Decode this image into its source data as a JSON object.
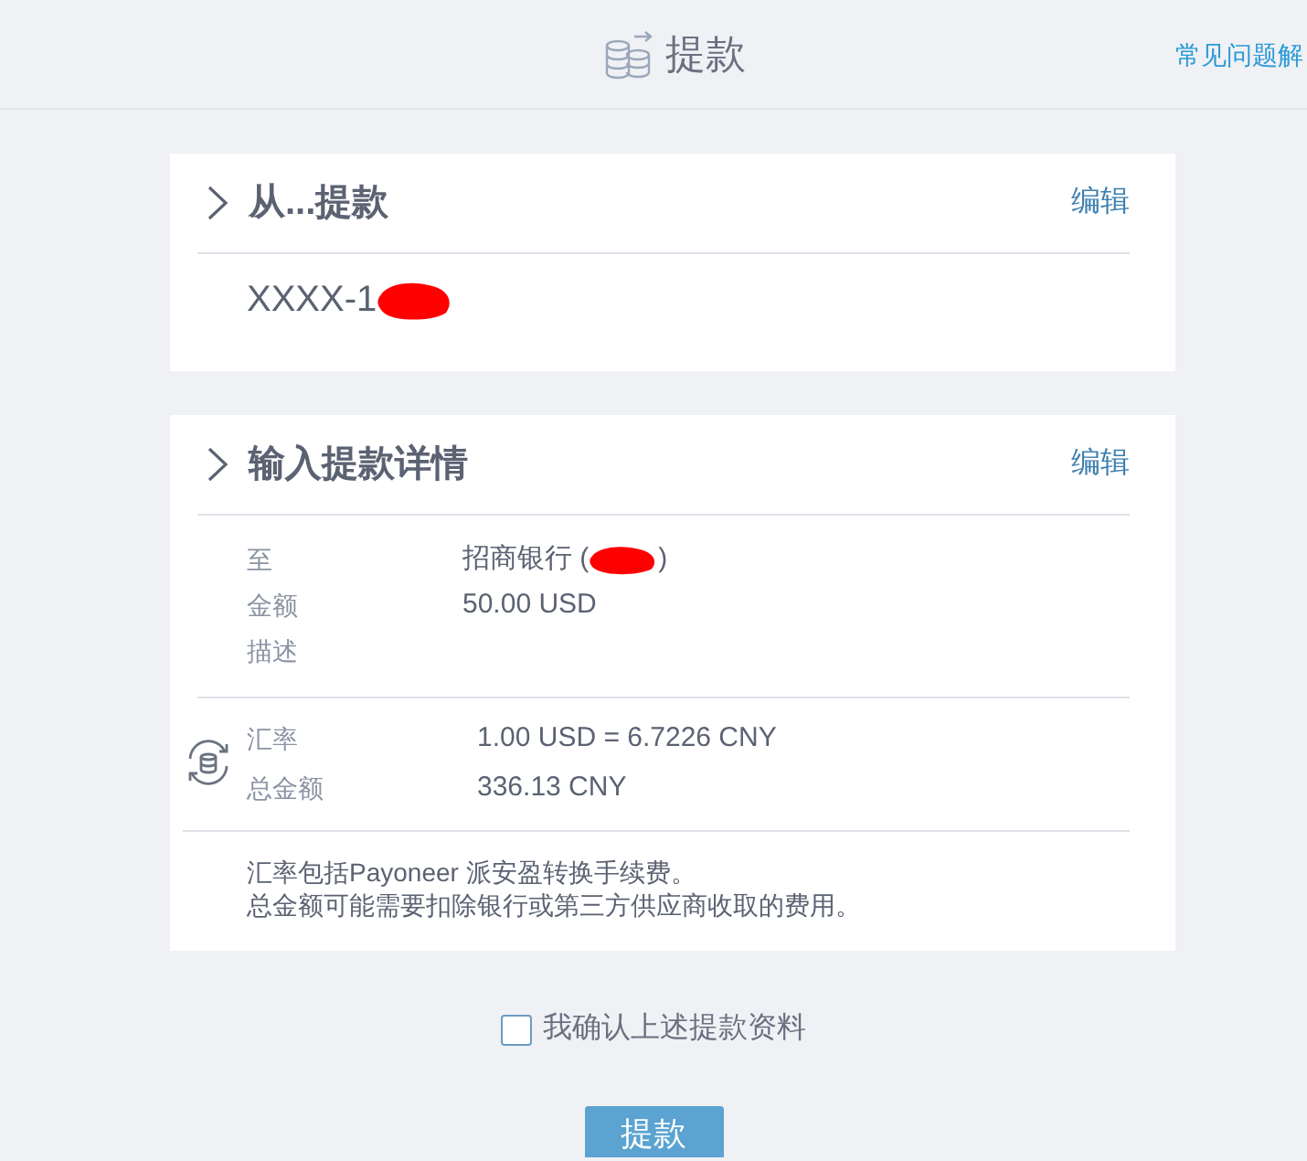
{
  "header": {
    "title": "提款",
    "help_link": "常见问题解"
  },
  "source_section": {
    "title": "从...提款",
    "edit_link": "编辑",
    "account": "XXXX-1",
    "account_redacted": true
  },
  "details_section": {
    "title": "输入提款详情",
    "edit_link": "编辑",
    "fields": [
      {
        "label": "至",
        "value": "招商银行 (",
        "value_end": ")",
        "redacted": true
      },
      {
        "label": "金额",
        "value": "50.00 USD"
      },
      {
        "label": "描述"
      }
    ],
    "conversion": [
      {
        "label": "汇率",
        "value": "1.00 USD = 6.7226 CNY"
      },
      {
        "label": "总金额",
        "value": "336.13 CNY"
      }
    ],
    "notes": [
      "汇率包括Payoneer 派安盈转换手续费。",
      "总金额可能需要扣除银行或第三方供应商收取的费用。"
    ]
  },
  "confirm": {
    "label": "我确认上述提款资料",
    "checked": false
  },
  "submit_button": "提款"
}
